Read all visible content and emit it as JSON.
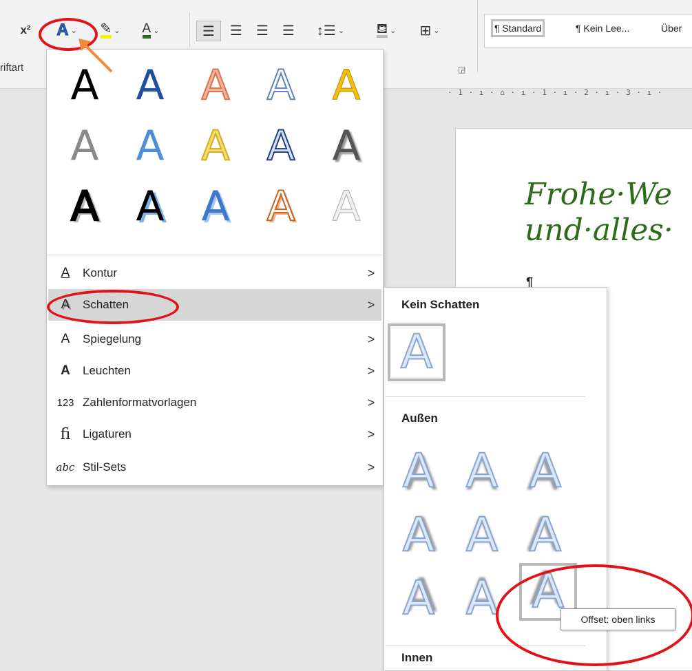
{
  "ribbon": {
    "superscript": "x²",
    "group_label": "riftart",
    "dialog_launcher": "◲",
    "styles": [
      "¶ Standard",
      "¶ Kein Lee...",
      "Über"
    ]
  },
  "ruler": "· 1 · ı · ⌂ · ı · 1 · ı · 2 · ı · 3 · ı ·",
  "document": {
    "line1": "Frohe·We",
    "line2": "und·alles·",
    "pilcrow": "¶"
  },
  "effects_menu": {
    "gallery_glyph": "A",
    "items": [
      {
        "label": "Kontur",
        "icon": "outline-A-icon"
      },
      {
        "label": "Schatten",
        "icon": "shadow-A-icon"
      },
      {
        "label": "Spiegelung",
        "icon": "reflection-A-icon"
      },
      {
        "label": "Leuchten",
        "icon": "glow-A-icon"
      },
      {
        "label": "Zahlenformatvorlagen",
        "icon": "number-style-icon"
      },
      {
        "label": "Ligaturen",
        "icon": "ligature-icon"
      },
      {
        "label": "Stil-Sets",
        "icon": "stylistic-set-icon"
      }
    ],
    "highlighted_index": 1
  },
  "shadow_submenu": {
    "none_heading": "Kein Schatten",
    "outer_heading": "Außen",
    "inner_heading": "Innen",
    "tooltip": "Offset: oben links"
  },
  "colors": {
    "annotation": "#e0131b",
    "arrow": "#f08a3c",
    "doc_text": "#2d6a1a"
  }
}
